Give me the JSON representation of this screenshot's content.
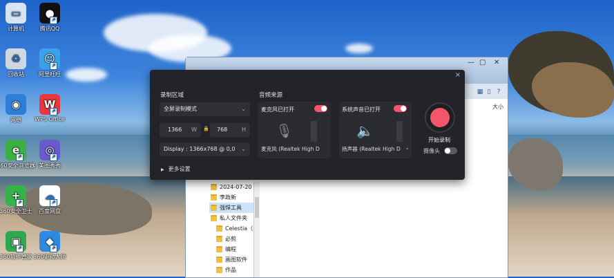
{
  "desktop": {
    "icons": [
      {
        "label": "计算机",
        "icon": "computer-icon",
        "color": "#d6e3f0",
        "glyph": "▭",
        "shortcut": false
      },
      {
        "label": "腾讯QQ",
        "icon": "qq-penguin-icon",
        "color": "#111111",
        "glyph": "●",
        "shortcut": true
      },
      {
        "label": "回收站",
        "icon": "recycle-bin-icon",
        "color": "#cfd8e0",
        "glyph": "♻",
        "shortcut": false
      },
      {
        "label": "阿里旺旺",
        "icon": "wangwang-icon",
        "color": "#3aa1e8",
        "glyph": "☺",
        "shortcut": true
      },
      {
        "label": "网络",
        "icon": "network-globe-icon",
        "color": "#2c7ed6",
        "glyph": "◉",
        "shortcut": false
      },
      {
        "label": "WPS Office",
        "icon": "wps-office-icon",
        "color": "#e8383d",
        "glyph": "W",
        "shortcut": true
      },
      {
        "label": "360安全浏览器",
        "icon": "360-browser-icon",
        "color": "#3cb043",
        "glyph": "e",
        "shortcut": true
      },
      {
        "label": "美图秀秀",
        "icon": "meitu-icon",
        "color": "#6a5acd",
        "glyph": "◎",
        "shortcut": true
      },
      {
        "label": "360安全卫士",
        "icon": "360-security-icon",
        "color": "#36b24a",
        "glyph": "+",
        "shortcut": true
      },
      {
        "label": "百度网盘",
        "icon": "baidu-netdisk-icon",
        "color": "#ffffff",
        "glyph": "☁",
        "shortcut": true
      },
      {
        "label": "360软件管家",
        "icon": "360-software-manager-icon",
        "color": "#2fa84f",
        "glyph": "▣",
        "shortcut": true
      },
      {
        "label": "360驱动大师",
        "icon": "360-driver-icon",
        "color": "#2d8ae0",
        "glyph": "◆",
        "shortcut": true
      }
    ]
  },
  "explorer": {
    "column_header": "大小",
    "toolbar_icons": [
      "view-icon",
      "pane-icon",
      "help-icon"
    ],
    "tree": [
      {
        "label": "2024-07-20"
      },
      {
        "label": "李政新"
      },
      {
        "label": "强悍工具",
        "selected": true
      },
      {
        "label": "私人文件夹"
      },
      {
        "label": "Celestia（"
      },
      {
        "label": "必剪"
      },
      {
        "label": "编程"
      },
      {
        "label": "画图软件"
      },
      {
        "label": "作品"
      }
    ]
  },
  "recorder": {
    "close_glyph": "×",
    "area": {
      "title": "录制区域",
      "mode": "全屏录制模式",
      "width": "1366",
      "width_unit": "W",
      "height": "768",
      "height_unit": "H",
      "display": "Display : 1366x768 @ 0,0"
    },
    "audio": {
      "title": "音频来源",
      "mic": {
        "name": "麦克风已打开",
        "device": "麦克风 (Realtek High D",
        "on": true
      },
      "system": {
        "name": "系统声音已打开",
        "device": "扬声器 (Realtek High D",
        "on": true
      }
    },
    "start_label": "开始录制",
    "camera_label": "摄像头",
    "camera_on": false,
    "more_settings": "更多设置",
    "colors": {
      "accent": "#f2566b",
      "toggle_off": "#5a5b60"
    }
  }
}
